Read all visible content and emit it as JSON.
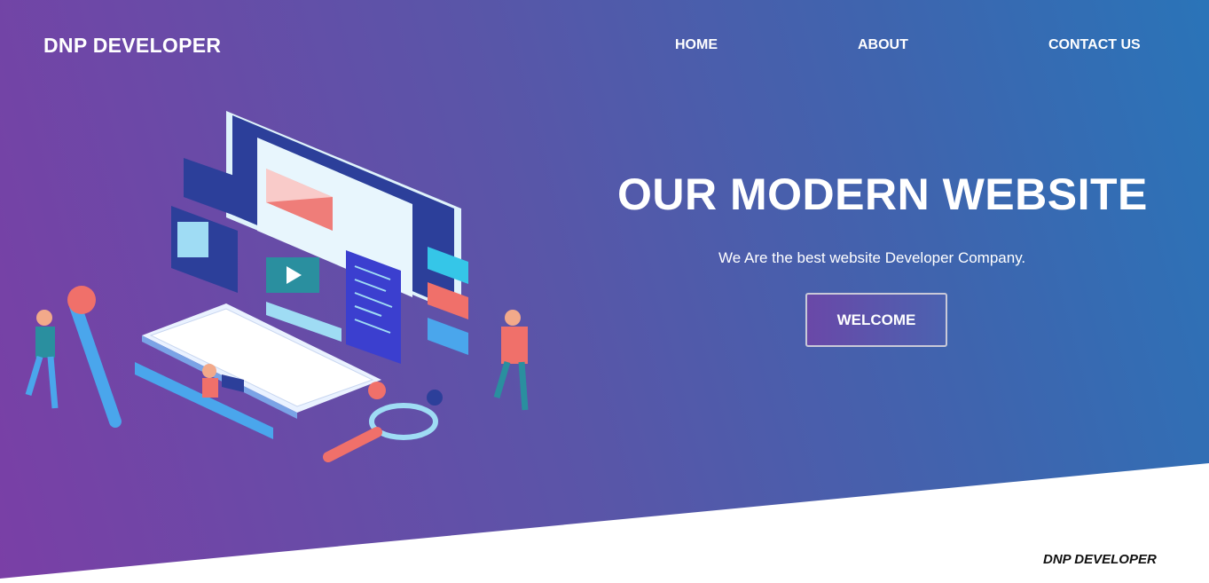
{
  "header": {
    "brand": "DNP DEVELOPER",
    "nav": [
      "HOME",
      "ABOUT",
      "CONTACT US"
    ]
  },
  "hero": {
    "title": "OUR MODERN WEBSITE",
    "subtitle": "We Are the best website Developer Company.",
    "cta_label": "WELCOME"
  },
  "footer": {
    "brand": "DNP DEVELOPER"
  },
  "colors": {
    "gradient_start": "#7a3fa6",
    "gradient_end": "#2a74b8",
    "text": "#ffffff",
    "accent_red": "#f0706a",
    "accent_cyan": "#35c6e8"
  }
}
